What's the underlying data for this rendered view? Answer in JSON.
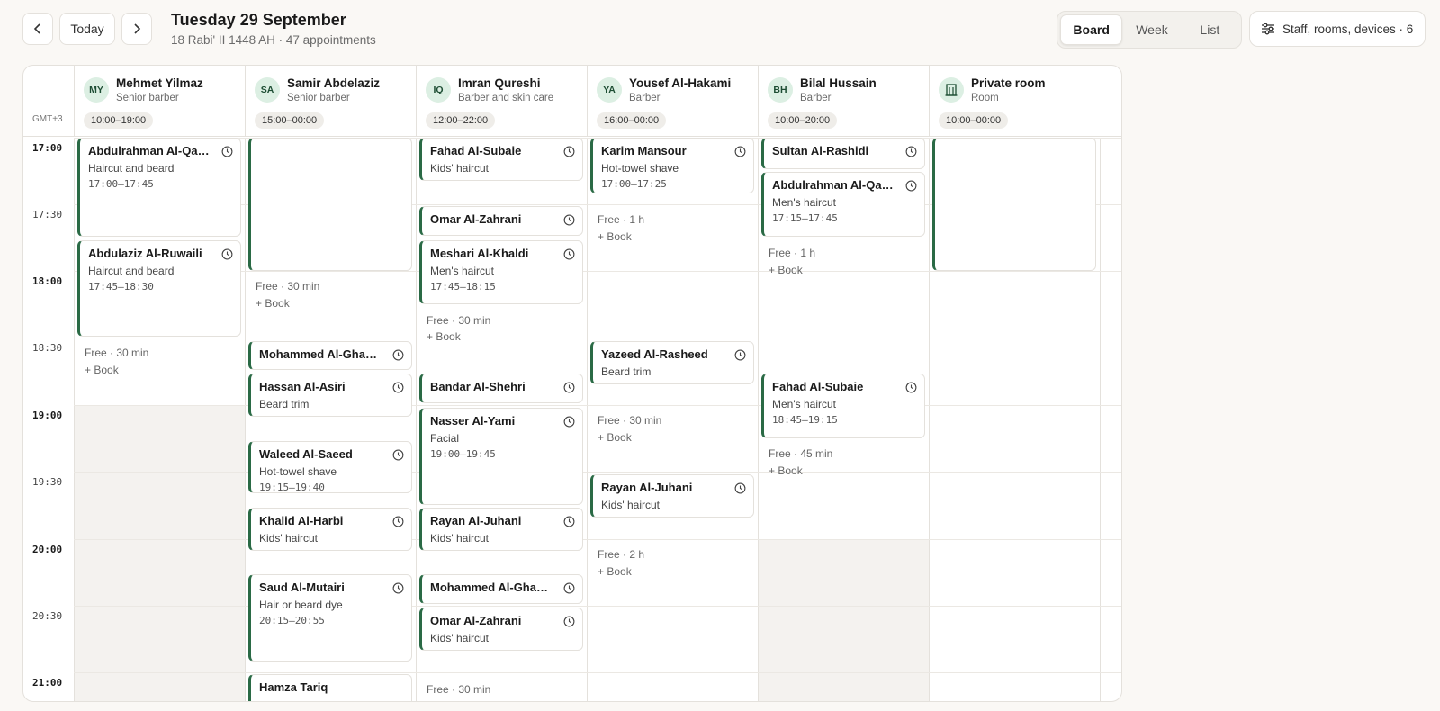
{
  "header": {
    "prev_label": "‹",
    "today_label": "Today",
    "next_label": "›",
    "title": "Tuesday 29 September",
    "subtitle": "18 Rabi' II 1448 AH · 47 appointments",
    "views": [
      "Board",
      "Week",
      "List"
    ],
    "active_view": "Board",
    "filter_label": "Staff, rooms, devices · 6"
  },
  "board": {
    "timezone": "GMT+3",
    "time_labels": [
      "17:00",
      "17:30",
      "18:00",
      "18:30",
      "19:00",
      "19:30",
      "20:00",
      "20:30",
      "21:00"
    ],
    "free_label_template": "Free",
    "book_label": "+ Book",
    "columns": [
      {
        "initials": "MY",
        "name": "Mehmet Yilmaz",
        "role": "Senior barber",
        "hours": "10:00–19:00",
        "appointments": [
          {
            "client": "Abdulrahman Al-Qah…",
            "service": "Haircut and beard",
            "time": "17:00–17:45"
          },
          {
            "client": "Abdulaziz Al-Ruwaili",
            "service": "Haircut and beard",
            "time": "17:45–18:30"
          }
        ],
        "free": [
          {
            "text": "Free · 30 min",
            "book": "+ Book"
          }
        ]
      },
      {
        "initials": "SA",
        "name": "Samir Abdelaziz",
        "role": "Senior barber",
        "hours": "15:00–00:00",
        "appointments": [
          {
            "client": "Mohammed Al-Gham…",
            "service": "",
            "time": ""
          },
          {
            "client": "Hassan Al-Asiri",
            "service": "Beard trim",
            "time": ""
          },
          {
            "client": "Waleed Al-Saeed",
            "service": "Hot-towel shave",
            "time": "19:15–19:40"
          },
          {
            "client": "Khalid Al-Harbi",
            "service": "Kids' haircut",
            "time": ""
          },
          {
            "client": "Saud Al-Mutairi",
            "service": "Hair or beard dye",
            "time": "20:15–20:55"
          },
          {
            "client": "Hamza Tariq",
            "service": "",
            "time": ""
          }
        ],
        "free": [
          {
            "text": "Free · 30 min",
            "book": "+ Book"
          }
        ]
      },
      {
        "initials": "IQ",
        "name": "Imran Qureshi",
        "role": "Barber and skin care",
        "hours": "12:00–22:00",
        "appointments": [
          {
            "client": "Fahad Al-Subaie",
            "service": "Kids' haircut",
            "time": ""
          },
          {
            "client": "Omar Al-Zahrani",
            "service": "",
            "time": ""
          },
          {
            "client": "Meshari Al-Khaldi",
            "service": "Men's haircut",
            "time": "17:45–18:15"
          },
          {
            "client": "Bandar Al-Shehri",
            "service": "",
            "time": ""
          },
          {
            "client": "Nasser Al-Yami",
            "service": "Facial",
            "time": "19:00–19:45"
          },
          {
            "client": "Rayan Al-Juhani",
            "service": "Kids' haircut",
            "time": ""
          },
          {
            "client": "Mohammed Al-Gham…",
            "service": "",
            "time": ""
          },
          {
            "client": "Omar Al-Zahrani",
            "service": "Kids' haircut",
            "time": ""
          }
        ],
        "free": [
          {
            "text": "Free · 30 min",
            "book": "+ Book"
          },
          {
            "text": "Free · 30 min",
            "book": ""
          }
        ]
      },
      {
        "initials": "YA",
        "name": "Yousef Al-Hakami",
        "role": "Barber",
        "hours": "16:00–00:00",
        "appointments": [
          {
            "client": "Karim Mansour",
            "service": "Hot-towel shave",
            "time": "17:00–17:25"
          },
          {
            "client": "Yazeed Al-Rasheed",
            "service": "Beard trim",
            "time": ""
          },
          {
            "client": "Rayan Al-Juhani",
            "service": "Kids' haircut",
            "time": ""
          }
        ],
        "free": [
          {
            "text": "Free · 1 h",
            "book": "+ Book"
          },
          {
            "text": "Free · 30 min",
            "book": "+ Book"
          },
          {
            "text": "Free · 2 h",
            "book": "+ Book"
          }
        ]
      },
      {
        "initials": "BH",
        "name": "Bilal Hussain",
        "role": "Barber",
        "hours": "10:00–20:00",
        "appointments": [
          {
            "client": "Sultan Al-Rashidi",
            "service": "",
            "time": ""
          },
          {
            "client": "Abdulrahman Al-Qah…",
            "service": "Men's haircut",
            "time": "17:15–17:45"
          },
          {
            "client": "Fahad Al-Subaie",
            "service": "Men's haircut",
            "time": "18:45–19:15"
          }
        ],
        "free": [
          {
            "text": "Free · 1 h",
            "book": "+ Book"
          },
          {
            "text": "Free · 45 min",
            "book": "+ Book"
          }
        ]
      },
      {
        "initials": "",
        "icon": "building-icon",
        "name": "Private room",
        "role": "Room",
        "hours": "10:00–00:00",
        "appointments": [],
        "free": []
      }
    ]
  },
  "colors": {
    "accent": "#2a6a45",
    "avatar_bg": "#dcefe3",
    "border": "#e4e1dc"
  }
}
